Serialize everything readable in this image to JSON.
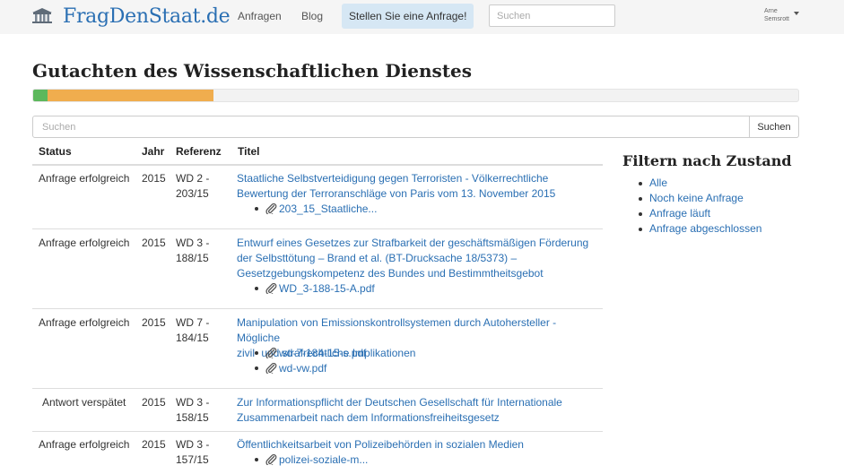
{
  "navbar": {
    "brand": "FragDenStaat.de",
    "links": [
      "Anfragen",
      "Blog"
    ],
    "cta": "Stellen Sie eine Anfrage!",
    "search_placeholder": "Suchen",
    "user_first": "Arne",
    "user_last": "Semsrott",
    "brand_color": "#2a6fb3"
  },
  "page": {
    "title": "Gutachten des Wissenschaftlichen Dienstes",
    "progress": {
      "segments": [
        {
          "status": "success",
          "fraction": 0.019,
          "color": "#5cb85c"
        },
        {
          "status": "pending",
          "fraction": 0.217,
          "color": "#f0ad4e"
        }
      ]
    },
    "search_placeholder": "Suchen",
    "search_button": "Suchen"
  },
  "table": {
    "headers": {
      "status": "Status",
      "year": "Jahr",
      "ref": "Referenz",
      "title": "Titel"
    },
    "rows": [
      {
        "status": "Anfrage erfolgreich",
        "year": "2015",
        "ref_lines": [
          "WD 2 -",
          "203/15"
        ],
        "title_lines": [
          "Staatliche Selbstverteidigung gegen Terroristen - Völkerrechtliche",
          "Bewertung der Terroranschläge von Paris vom 13. November 2015"
        ],
        "attachments": [
          "203_15_Staatliche..."
        ]
      },
      {
        "status": "Anfrage erfolgreich",
        "year": "2015",
        "ref_lines": [
          "WD 3 -",
          "188/15"
        ],
        "title_lines": [
          "Entwurf eines Gesetzes zur Strafbarkeit der geschäftsmäßigen Förderung",
          "der Selbsttötung – Brand et al. (BT-Drucksache 18/5373) –",
          "Gesetzgebungskompetenz des Bundes und Bestimmtheitsgebot"
        ],
        "attachments": [
          "WD_3-188-15-A.pdf"
        ]
      },
      {
        "status": "Anfrage erfolgreich",
        "year": "2015",
        "ref_lines": [
          "WD 7 -",
          "184/15"
        ],
        "title_lines": [
          "Manipulation von Emissionskontrollsystemen durch Autohersteller - Mögliche",
          "zivil- und strafrechtliche Implikationen"
        ],
        "attachments": [
          "wd-7-184-15-s.pdf",
          "wd-vw.pdf"
        ]
      },
      {
        "status": "Antwort verspätet",
        "year": "2015",
        "ref_lines": [
          "WD 3 -",
          "158/15"
        ],
        "title_lines": [
          "Zur Informationspflicht der Deutschen Gesellschaft für Internationale",
          "Zusammenarbeit nach dem Informationsfreiheitsgesetz"
        ],
        "attachments": []
      },
      {
        "status": "Anfrage erfolgreich",
        "year": "2015",
        "ref_lines": [
          "WD 3 -",
          "157/15"
        ],
        "title_lines": [
          "Öffentlichkeitsarbeit von Polizeibehörden in sozialen Medien"
        ],
        "attachments": [
          "polizei-soziale-m..."
        ]
      }
    ]
  },
  "sidebar": {
    "heading": "Filtern nach Zustand",
    "items": [
      "Alle",
      "Noch keine Anfrage",
      "Anfrage läuft",
      "Anfrage abgeschlossen"
    ]
  }
}
